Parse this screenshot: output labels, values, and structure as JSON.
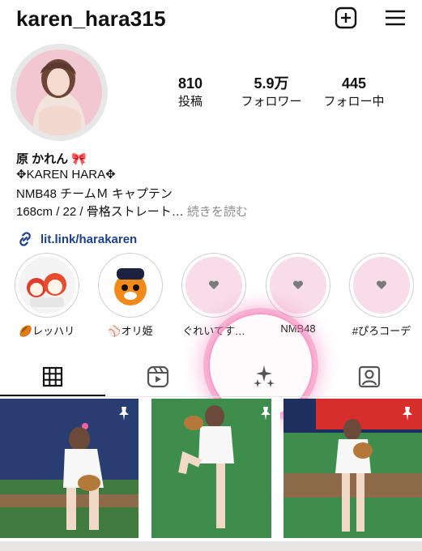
{
  "header": {
    "username": "karen_hara315"
  },
  "stats": [
    {
      "value": "810",
      "label": "投稿"
    },
    {
      "value": "5.9万",
      "label": "フォロワー"
    },
    {
      "value": "445",
      "label": "フォロー中"
    }
  ],
  "bio": {
    "name": "原 かれん 🎀",
    "line1": "✥KAREN HARA✥",
    "line2": "NMB48 チームＭ キャプテン",
    "line3": "168cm / 22 / 骨格ストレート…",
    "more": "続きを読む",
    "link": "lit.link/harakaren"
  },
  "highlights": [
    {
      "label": "🏉レッハリ"
    },
    {
      "label": "⚾オリ姫"
    },
    {
      "label": "ぐれいてす…"
    },
    {
      "label": "NMB48"
    },
    {
      "label": "#ぴろコーデ"
    }
  ],
  "colors": {
    "link": "#1c3f8f",
    "highlight_bg": "#f8dde8",
    "pink_ring": "#f06eaa"
  }
}
